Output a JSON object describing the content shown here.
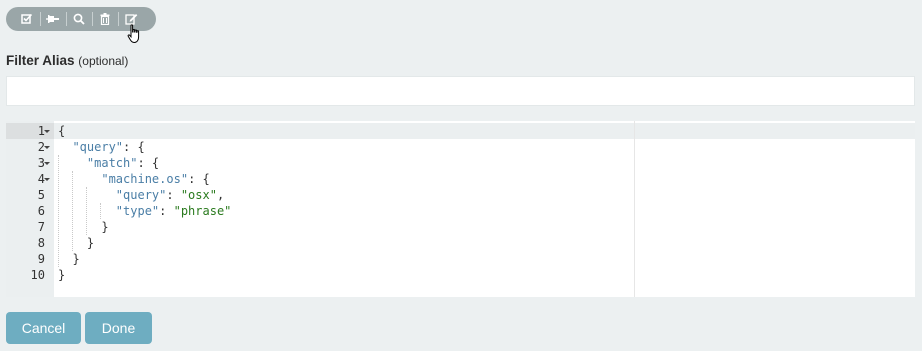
{
  "toolbar": {
    "buttons": [
      {
        "icon": "checkbox-icon"
      },
      {
        "icon": "pin-icon"
      },
      {
        "icon": "search-icon"
      },
      {
        "icon": "trash-icon"
      },
      {
        "icon": "edit-icon"
      }
    ]
  },
  "filter_alias": {
    "label": "Filter Alias",
    "optional": "(optional)",
    "value": "",
    "placeholder": ""
  },
  "editor": {
    "lines": [
      {
        "number": "1",
        "text": "{"
      },
      {
        "number": "2",
        "text": "  \"query\": {"
      },
      {
        "number": "3",
        "text": "    \"match\": {"
      },
      {
        "number": "4",
        "text": "      \"machine.os\": {"
      },
      {
        "number": "5",
        "text": "        \"query\": \"osx\","
      },
      {
        "number": "6",
        "text": "        \"type\": \"phrase\""
      },
      {
        "number": "7",
        "text": "      }"
      },
      {
        "number": "8",
        "text": "    }"
      },
      {
        "number": "9",
        "text": "  }"
      },
      {
        "number": "10",
        "text": "}"
      }
    ]
  },
  "actions": {
    "cancel": "Cancel",
    "done": "Done"
  },
  "colors": {
    "toolbar_bg": "#9aa6a8",
    "button_bg": "#6eadc1",
    "json_key": "#4a7ea6",
    "json_string": "#2a7a1e"
  }
}
